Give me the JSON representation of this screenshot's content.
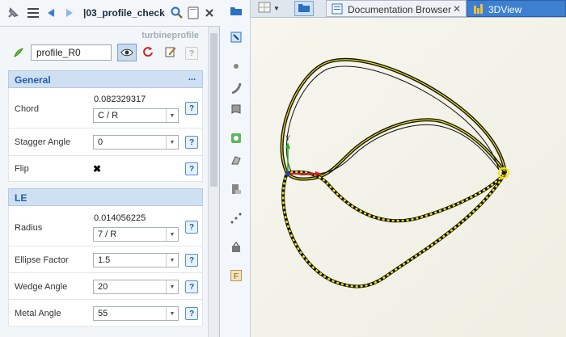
{
  "panel": {
    "title": "|03_profile_check",
    "brand": "turbineprofile",
    "object_name": "profile_R0",
    "sections": [
      {
        "title": "General",
        "more": "..."
      },
      {
        "title": "LE"
      }
    ],
    "general": {
      "chord": {
        "label": "Chord",
        "value": "0.082329317",
        "combo": "C / R"
      },
      "stagger": {
        "label": "Stagger Angle",
        "combo": "0"
      },
      "flip": {
        "label": "Flip",
        "mark": "✖"
      }
    },
    "le": {
      "radius": {
        "label": "Radius",
        "value": "0.014056225",
        "combo": "7 / R"
      },
      "ellipse": {
        "label": "Ellipse Factor",
        "combo": "1.5"
      },
      "wedge": {
        "label": "Wedge Angle",
        "combo": "20"
      },
      "metal": {
        "label": "Metal Angle",
        "combo": "55"
      }
    },
    "help": "?"
  },
  "tabs": [
    {
      "label": "Documentation Browser",
      "close": "✕"
    },
    {
      "label": "3DView",
      "active": true
    }
  ],
  "viewport": {
    "axis_label": "Y"
  },
  "colors": {
    "section_title": "#1f5ea8",
    "accent": "#2c6fc4",
    "curve": "#f2e600"
  }
}
